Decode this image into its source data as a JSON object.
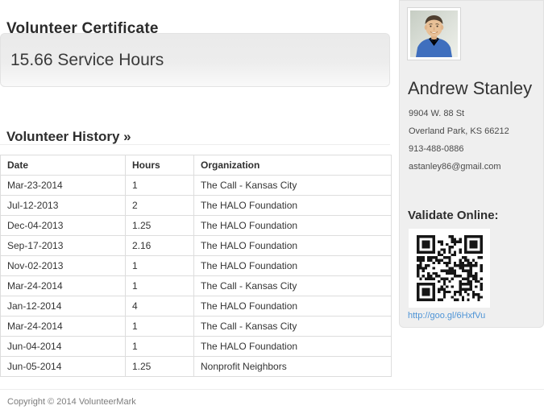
{
  "page": {
    "title": "Volunteer Certificate",
    "service_hours_banner": "15.66 Service Hours",
    "history_heading": "Volunteer History »",
    "footer": "Copyright © 2014 VolunteerMark"
  },
  "history": {
    "columns": [
      "Date",
      "Hours",
      "Organization"
    ],
    "rows": [
      [
        "Mar-23-2014",
        "1",
        "The Call - Kansas City"
      ],
      [
        "Jul-12-2013",
        "2",
        "The HALO Foundation"
      ],
      [
        "Dec-04-2013",
        "1.25",
        "The HALO Foundation"
      ],
      [
        "Sep-17-2013",
        "2.16",
        "The HALO Foundation"
      ],
      [
        "Nov-02-2013",
        "1",
        "The HALO Foundation"
      ],
      [
        "Mar-24-2014",
        "1",
        "The Call - Kansas City"
      ],
      [
        "Jan-12-2014",
        "4",
        "The HALO Foundation"
      ],
      [
        "Mar-24-2014",
        "1",
        "The Call - Kansas City"
      ],
      [
        "Jun-04-2014",
        "1",
        "The HALO Foundation"
      ],
      [
        "Jun-05-2014",
        "1.25",
        "Nonprofit Neighbors"
      ]
    ]
  },
  "profile": {
    "name": "Andrew Stanley",
    "address_line1": "9904 W. 88 St",
    "address_line2": "Overland Park, KS 66212",
    "phone": "913-488-0886",
    "email": "astanley86@gmail.com",
    "validate_label": "Validate Online:",
    "validate_url": "http://goo.gl/6HxfVu"
  },
  "colors": {
    "link_blue": "#4e94d6",
    "sidebar_bg": "#efefef",
    "table_border": "#dddddd",
    "shirt_blue": "#3f6fbe"
  }
}
